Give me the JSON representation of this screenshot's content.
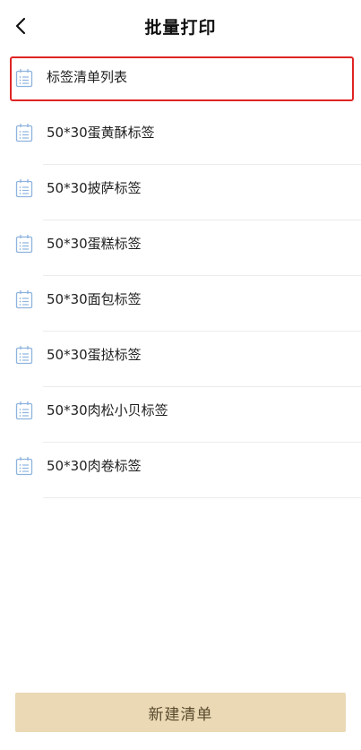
{
  "header": {
    "title": "批量打印",
    "back_icon": "chevron-left-icon"
  },
  "list": {
    "items": [
      {
        "label": "标签清单列表",
        "icon": "calendar-list-icon",
        "selected": true
      },
      {
        "label": "50*30蛋黄酥标签",
        "icon": "calendar-list-icon"
      },
      {
        "label": "50*30披萨标签",
        "icon": "calendar-list-icon"
      },
      {
        "label": "50*30蛋糕标签",
        "icon": "calendar-list-icon"
      },
      {
        "label": "50*30面包标签",
        "icon": "calendar-list-icon"
      },
      {
        "label": "50*30蛋挞标签",
        "icon": "calendar-list-icon"
      },
      {
        "label": "50*30肉松小贝标签",
        "icon": "calendar-list-icon"
      },
      {
        "label": "50*30肉卷标签",
        "icon": "calendar-list-icon"
      }
    ]
  },
  "footer": {
    "new_list_label": "新建清单"
  },
  "colors": {
    "highlight_border": "#e02424",
    "icon_color": "#8eb3de",
    "button_bg": "#ead9b4",
    "button_text": "#5a4a2e"
  }
}
